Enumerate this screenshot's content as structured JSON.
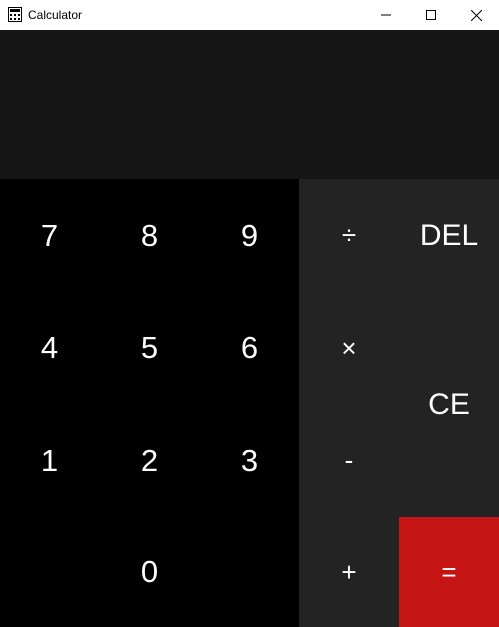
{
  "window": {
    "title": "Calculator",
    "controls": {
      "minimize": "minimize-icon",
      "maximize": "maximize-icon",
      "close": "close-icon"
    }
  },
  "display": {
    "value": ""
  },
  "keypad": {
    "digits": {
      "k7": "7",
      "k8": "8",
      "k9": "9",
      "k4": "4",
      "k5": "5",
      "k6": "6",
      "k1": "1",
      "k2": "2",
      "k3": "3",
      "k0": "0"
    },
    "operators": {
      "divide": "÷",
      "multiply": "×",
      "subtract": "-",
      "add": "+",
      "equals": "="
    },
    "actions": {
      "delete": "DEL",
      "clear_entry": "CE"
    }
  },
  "colors": {
    "display_bg": "#161616",
    "digit_bg": "#000000",
    "operator_bg": "#232323",
    "equals_bg": "#c41414",
    "text": "#ffffff",
    "titlebar_bg": "#ffffff"
  }
}
